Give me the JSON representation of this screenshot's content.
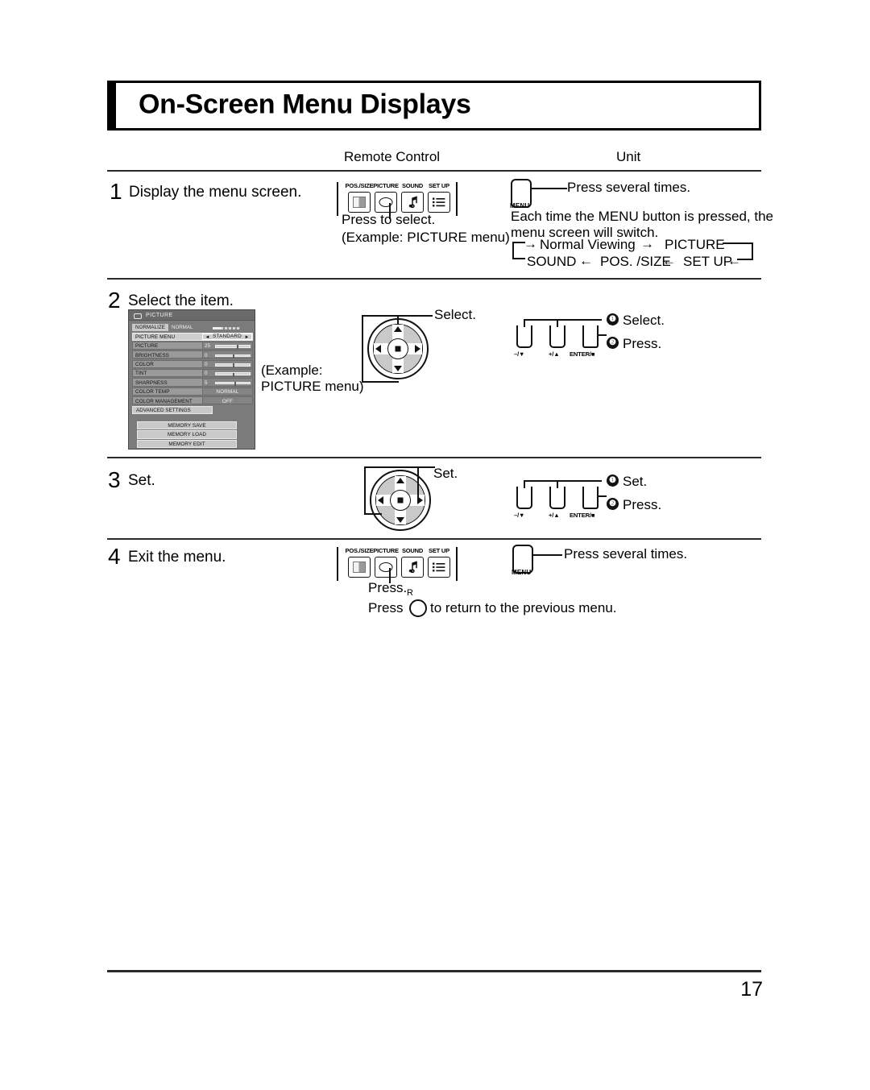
{
  "page": {
    "title": "On-Screen Menu Displays",
    "page_number": "17"
  },
  "columns": {
    "remote_control": "Remote Control",
    "unit": "Unit"
  },
  "steps": [
    {
      "number": "1",
      "label": "Display the menu screen.",
      "remote_note_1": "Press to select.",
      "remote_note_2": "(Example: PICTURE menu)",
      "unit_note": "Press several times.",
      "unit_body_1": "Each time the MENU button is pressed, the",
      "unit_body_2": "menu screen will switch."
    },
    {
      "number": "2",
      "label": "Select the item.",
      "remote_callout": "Select.",
      "example_line_1": "(Example:",
      "example_line_2": " PICTURE menu)",
      "unit_callout_1": "Select.",
      "unit_callout_2": "Press."
    },
    {
      "number": "3",
      "label": "Set.",
      "remote_callout": "Set.",
      "unit_callout_1": "Set.",
      "unit_callout_2": "Press."
    },
    {
      "number": "4",
      "label": "Exit the menu.",
      "remote_note_1": "Press.",
      "remote_note_2_a": "Press",
      "remote_note_2_b": "to return to the previous menu.",
      "return_button_label": "R",
      "unit_note": "Press several times."
    }
  ],
  "remote_buttons": [
    {
      "caption": "POS./SIZE",
      "icon": "possize-icon"
    },
    {
      "caption": "PICTURE",
      "icon": "picture-oval-icon"
    },
    {
      "caption": "SOUND",
      "icon": "sound-note-icon"
    },
    {
      "caption": "SET UP",
      "icon": "setup-list-icon"
    }
  ],
  "menu_button": {
    "caption": "MENU"
  },
  "menu_cycle": {
    "top": [
      "Normal Viewing",
      "PICTURE"
    ],
    "bottom": [
      "SOUND",
      "POS. /SIZE",
      "SET UP"
    ]
  },
  "unit_buttons": [
    {
      "caption": "–/▼",
      "name": "minus-down-button"
    },
    {
      "caption": "+/▲",
      "name": "plus-up-button"
    },
    {
      "caption": "ENTER/■",
      "name": "enter-button"
    }
  ],
  "callout_markers": {
    "one": "❶",
    "two": "❷"
  },
  "osd_menu": {
    "title": "PICTURE",
    "normalize": {
      "button": "NORMALIZE",
      "value": "NORMAL"
    },
    "rows": [
      {
        "label": "PICTURE MENU",
        "value": "STANDARD",
        "type": "option"
      },
      {
        "label": "PICTURE",
        "value": "25",
        "type": "slider",
        "pos": 62
      },
      {
        "label": "BRIGHTNESS",
        "value": "0",
        "type": "slider",
        "pos": 50
      },
      {
        "label": "COLOR",
        "value": "0",
        "type": "slider",
        "pos": 50
      },
      {
        "label": "TINT",
        "value": "0",
        "type": "slider",
        "pos": 50
      },
      {
        "label": "SHARPNESS",
        "value": "5",
        "type": "slider",
        "pos": 55
      },
      {
        "label": "COLOR TEMP",
        "value": "NORMAL",
        "type": "text"
      },
      {
        "label": "COLOR MANAGEMENT",
        "value": "OFF",
        "type": "text"
      }
    ],
    "advanced_settings": "ADVANCED SETTINGS",
    "memory_buttons": [
      "MEMORY SAVE",
      "MEMORY LOAD",
      "MEMORY EDIT"
    ]
  },
  "colors": {
    "ink": "#000000",
    "osd_background": "#7b7b7b",
    "osd_row": "#9a9a9a",
    "osd_highlight": "#cfcfcf"
  }
}
